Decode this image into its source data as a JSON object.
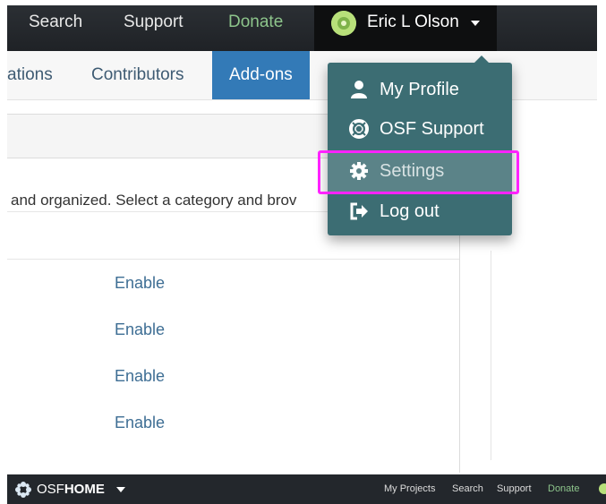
{
  "topnav": {
    "search": "Search",
    "support": "Support",
    "donate": "Donate",
    "user_name": "Eric L Olson"
  },
  "subnav": {
    "tabs": [
      "ations",
      "Contributors",
      "Add-ons"
    ],
    "active_tab": "Add-ons"
  },
  "content": {
    "description": "and organized. Select a category and brov",
    "rows": [
      "Enable",
      "Enable",
      "Enable",
      "Enable"
    ]
  },
  "dropdown": {
    "items": [
      {
        "label": "My Profile",
        "icon": "user-icon"
      },
      {
        "label": "OSF Support",
        "icon": "lifebuoy-icon"
      },
      {
        "label": "Settings",
        "icon": "gear-icon"
      },
      {
        "label": "Log out",
        "icon": "logout-icon"
      }
    ],
    "highlighted_item": "Settings"
  },
  "bottombar": {
    "brand_prefix": "OSF",
    "brand_main": "HOME",
    "links": [
      "My Projects",
      "Search",
      "Support",
      "Donate"
    ]
  },
  "colors": {
    "nav_bg": "#2b2f34",
    "donate": "#8dc48b",
    "active_tab": "#337ab7",
    "dropdown_bg": "#3c6d73",
    "link": "#3e6e94",
    "highlight": "#ff22ff"
  }
}
